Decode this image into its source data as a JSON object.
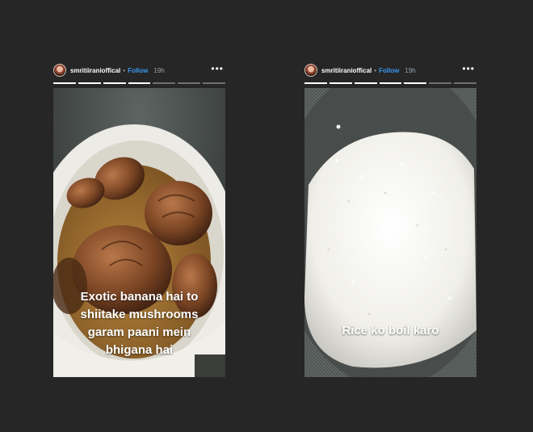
{
  "stories": [
    {
      "username": "smritiiranioffical",
      "separator": "•",
      "follow_label": "Follow",
      "time": "19h",
      "more_icon": "•••",
      "caption_lines": [
        "Exotic banana hai to",
        "shiitake mushrooms",
        "garam paani mein",
        "bhigana hai"
      ],
      "photo_icon": "mushrooms-in-bowl"
    },
    {
      "username": "smritiiranioffical",
      "separator": "•",
      "follow_label": "Follow",
      "time": "19h",
      "more_icon": "•••",
      "caption_lines": [
        "Rice ko boil karo"
      ],
      "photo_icon": "rice-in-strainer"
    }
  ],
  "colors": {
    "background": "#262626",
    "follow": "#3897f0"
  }
}
